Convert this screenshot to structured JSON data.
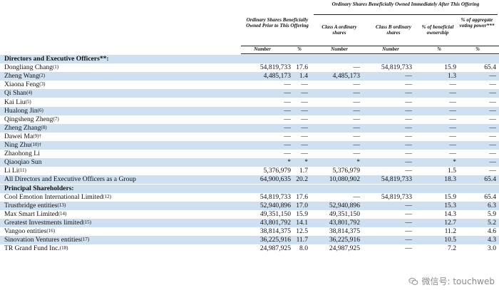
{
  "header": {
    "group_title": "Ordinary Shares Beneficially Owned Immediately After This Offering",
    "prior_title": "Ordinary Shares Beneficially Owned Prior to This Offering",
    "class_a": "Class A ordinary shares",
    "class_b": "Class B ordinary shares",
    "pct_ownership": "% of beneficial ownership",
    "pct_voting": "% of aggregate voting power***",
    "sub": [
      "Number",
      "%",
      "Number",
      "Number",
      "%",
      "%"
    ]
  },
  "sections": {
    "directors": "Directors and Executive Officers**:",
    "principal": "Principal Shareholders:"
  },
  "rows_directors": [
    {
      "name": "Dongliang Chang",
      "note": "(1)",
      "c1": "54,819,733",
      "c2": "17.6",
      "c3": "—",
      "c4": "54,819,733",
      "c5": "15.9",
      "c6": "65.4"
    },
    {
      "name": "Zheng Wang",
      "note": "(2)",
      "c1": "4,485,173",
      "c2": "1.4",
      "c3": "4,485,173",
      "c4": "—",
      "c5": "1.3",
      "c6": "—"
    },
    {
      "name": "Xiaona Feng",
      "note": "(3)",
      "c1": "—",
      "c2": "—",
      "c3": "—",
      "c4": "—",
      "c5": "—",
      "c6": "—"
    },
    {
      "name": "Qi Shan",
      "note": "(4)",
      "c1": "—",
      "c2": "—",
      "c3": "—",
      "c4": "—",
      "c5": "—",
      "c6": "—"
    },
    {
      "name": "Kai Liu",
      "note": "(5)",
      "c1": "—",
      "c2": "—",
      "c3": "—",
      "c4": "—",
      "c5": "—",
      "c6": "—"
    },
    {
      "name": "Hualong Jin",
      "note": "(6)",
      "c1": "—",
      "c2": "—",
      "c3": "—",
      "c4": "—",
      "c5": "—",
      "c6": "—"
    },
    {
      "name": "Qingsheng Zheng",
      "note": "(7)",
      "c1": "—",
      "c2": "—",
      "c3": "—",
      "c4": "—",
      "c5": "—",
      "c6": "—"
    },
    {
      "name": "Zheng Zhang",
      "note": "(8)",
      "c1": "—",
      "c2": "—",
      "c3": "—",
      "c4": "—",
      "c5": "—",
      "c6": "—"
    },
    {
      "name": "Dawei Ma",
      "note": "(9)†",
      "c1": "—",
      "c2": "—",
      "c3": "—",
      "c4": "—",
      "c5": "—",
      "c6": "—"
    },
    {
      "name": "Ning Zhu",
      "note": "(10)†",
      "c1": "—",
      "c2": "—",
      "c3": "—",
      "c4": "—",
      "c5": "—",
      "c6": "—"
    },
    {
      "name": "Zhaohong Li",
      "note": "",
      "c1": "—",
      "c2": "—",
      "c3": "—",
      "c4": "—",
      "c5": "—",
      "c6": "—"
    },
    {
      "name": "Qiaoqiao Sun",
      "note": "",
      "c1": "*",
      "c2": "*",
      "c3": "*",
      "c4": "—",
      "c5": "*",
      "c6": "—"
    },
    {
      "name": "Li Li",
      "note": "(11)",
      "c1": "5,376,979",
      "c2": "1.7",
      "c3": "5,376,979",
      "c4": "—",
      "c5": "1.5",
      "c6": "—"
    },
    {
      "name": "All Directors and Executive Officers as a Group",
      "note": "",
      "c1": "64,900,635",
      "c2": "20.2",
      "c3": "10,080,902",
      "c4": "54,819,733",
      "c5": "18.3",
      "c6": "65.4"
    }
  ],
  "rows_principal": [
    {
      "name": "Cool Emotion International Limited",
      "note": "(12)",
      "c1": "54,819,733",
      "c2": "17.6",
      "c3": "—",
      "c4": "54,819,733",
      "c5": "15.9",
      "c6": "65.4"
    },
    {
      "name": "Trustbridge entities",
      "note": "(13)",
      "c1": "52,940,896",
      "c2": "17.0",
      "c3": "52,940,896",
      "c4": "—",
      "c5": "15.3",
      "c6": "6.3"
    },
    {
      "name": "Max Smart Limited",
      "note": "(14)",
      "c1": "49,351,150",
      "c2": "15.9",
      "c3": "49,351,150",
      "c4": "—",
      "c5": "14.3",
      "c6": "5.9"
    },
    {
      "name": "Greatest Investments limited",
      "note": "(15)",
      "c1": "43,801,792",
      "c2": "14.1",
      "c3": "43,801,792",
      "c4": "—",
      "c5": "12.7",
      "c6": "5.2"
    },
    {
      "name": "Vangoo entities",
      "note": "(16)",
      "c1": "38,814,375",
      "c2": "12.5",
      "c3": "38,814,375",
      "c4": "—",
      "c5": "11.2",
      "c6": "4.6"
    },
    {
      "name": "Sinovation Ventures entities",
      "note": "(17)",
      "c1": "36,225,916",
      "c2": "11.7",
      "c3": "36,225,916",
      "c4": "—",
      "c5": "10.5",
      "c6": "4.3"
    },
    {
      "name": "TR Grand Fund Inc.",
      "note": "(18)",
      "c1": "24,987,925",
      "c2": "8.0",
      "c3": "24,987,925",
      "c4": "—",
      "c5": "7.2",
      "c6": "3.0"
    }
  ],
  "watermark": {
    "text": "微信号: touchweb",
    "icon": "wechat-icon"
  }
}
